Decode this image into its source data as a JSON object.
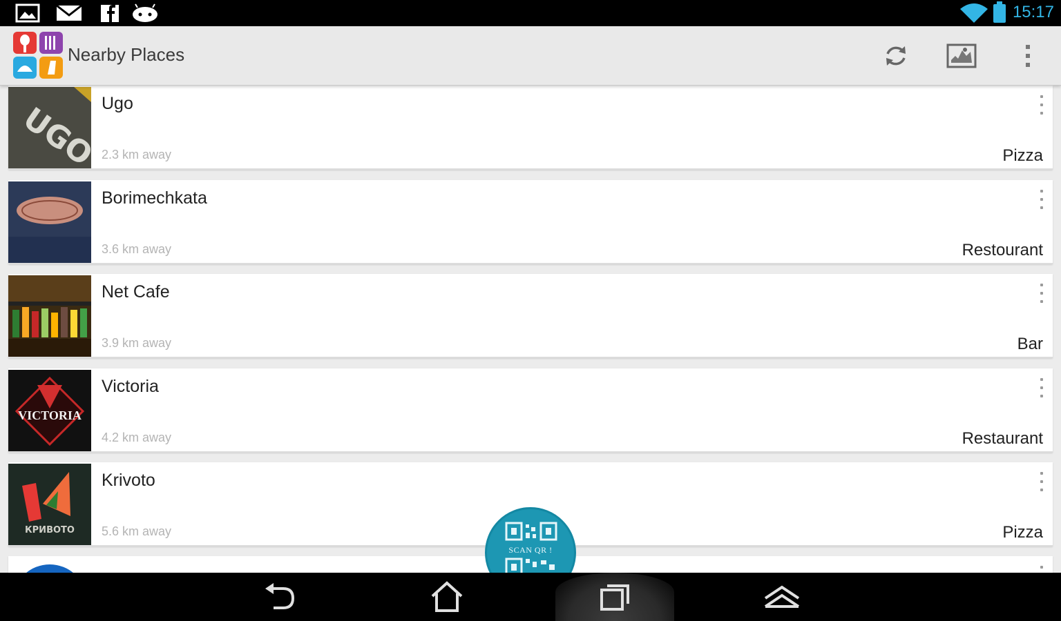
{
  "status_bar": {
    "time": "15:17",
    "icons": [
      "gallery-icon",
      "gmail-icon",
      "facebook-icon",
      "android-icon",
      "wifi-icon",
      "battery-icon"
    ]
  },
  "action_bar": {
    "title": "Nearby Places",
    "actions": [
      "refresh-icon",
      "map-icon",
      "overflow-menu-icon"
    ]
  },
  "places": [
    {
      "name": "Ugo",
      "distance": "2.3 km away",
      "category": "Pizza"
    },
    {
      "name": "Borimechkata",
      "distance": "3.6 km away",
      "category": "Restourant"
    },
    {
      "name": "Net Cafe",
      "distance": "3.9 km away",
      "category": "Bar"
    },
    {
      "name": "Victoria",
      "distance": "4.2 km away",
      "category": "Restaurant"
    },
    {
      "name": "Krivoto",
      "distance": "5.6 km away",
      "category": "Pizza"
    }
  ],
  "thumb_text": {
    "ugo": "UGO",
    "victoria": "VICTORIA",
    "krivoto": "КРИВОТО"
  },
  "fab": {
    "label": "SCAN QR !"
  },
  "nav_bar": [
    "back-icon",
    "home-icon",
    "recents-icon",
    "menu-up-icon"
  ],
  "colors": {
    "accent": "#33b5e5",
    "fab": "#1d97b3",
    "actionbar": "#e9e9e9"
  }
}
